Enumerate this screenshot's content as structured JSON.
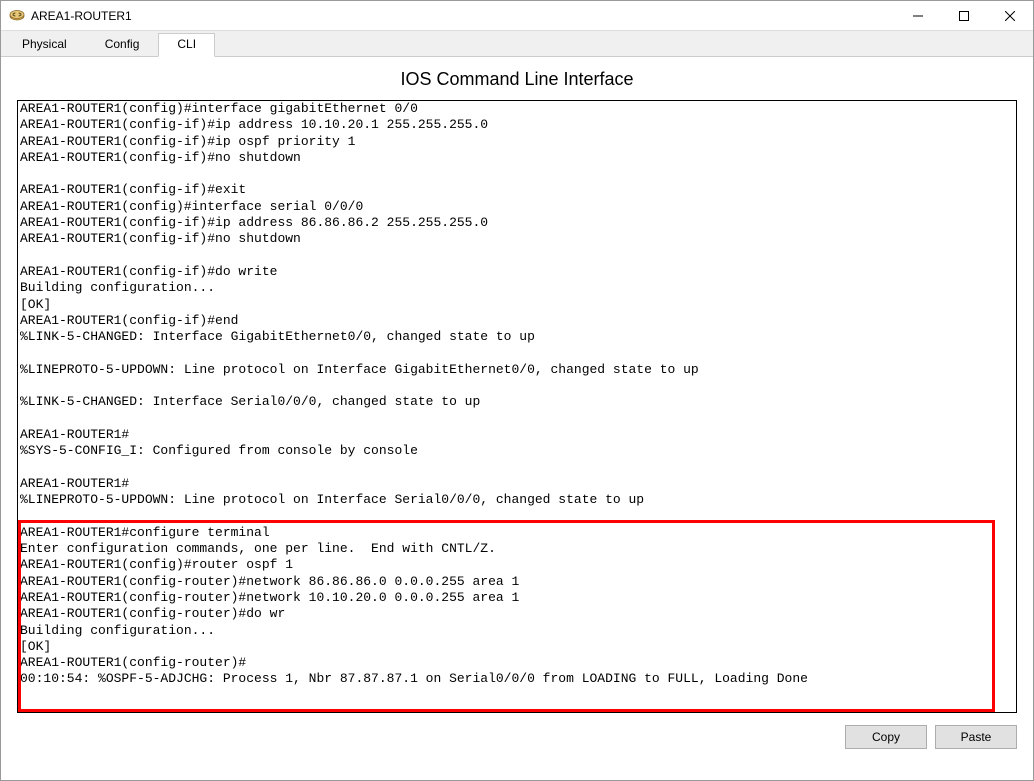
{
  "window": {
    "title": "AREA1-ROUTER1"
  },
  "tabs": {
    "physical": "Physical",
    "config": "Config",
    "cli": "CLI"
  },
  "cli": {
    "heading": "IOS Command Line Interface",
    "output": "AREA1-ROUTER1(config)#interface gigabitEthernet 0/0\nAREA1-ROUTER1(config-if)#ip address 10.10.20.1 255.255.255.0\nAREA1-ROUTER1(config-if)#ip ospf priority 1\nAREA1-ROUTER1(config-if)#no shutdown\n\nAREA1-ROUTER1(config-if)#exit\nAREA1-ROUTER1(config)#interface serial 0/0/0\nAREA1-ROUTER1(config-if)#ip address 86.86.86.2 255.255.255.0\nAREA1-ROUTER1(config-if)#no shutdown\n\nAREA1-ROUTER1(config-if)#do write\nBuilding configuration...\n[OK]\nAREA1-ROUTER1(config-if)#end\n%LINK-5-CHANGED: Interface GigabitEthernet0/0, changed state to up\n\n%LINEPROTO-5-UPDOWN: Line protocol on Interface GigabitEthernet0/0, changed state to up\n\n%LINK-5-CHANGED: Interface Serial0/0/0, changed state to up\n\nAREA1-ROUTER1#\n%SYS-5-CONFIG_I: Configured from console by console\n\nAREA1-ROUTER1#\n%LINEPROTO-5-UPDOWN: Line protocol on Interface Serial0/0/0, changed state to up\n\nAREA1-ROUTER1#configure terminal\nEnter configuration commands, one per line.  End with CNTL/Z.\nAREA1-ROUTER1(config)#router ospf 1\nAREA1-ROUTER1(config-router)#network 86.86.86.0 0.0.0.255 area 1\nAREA1-ROUTER1(config-router)#network 10.10.20.0 0.0.0.255 area 1\nAREA1-ROUTER1(config-router)#do wr\nBuilding configuration...\n[OK]\nAREA1-ROUTER1(config-router)#\n00:10:54: %OSPF-5-ADJCHG: Process 1, Nbr 87.87.87.1 on Serial0/0/0 from LOADING to FULL, Loading Done\n"
  },
  "buttons": {
    "copy": "Copy",
    "paste": "Paste"
  }
}
